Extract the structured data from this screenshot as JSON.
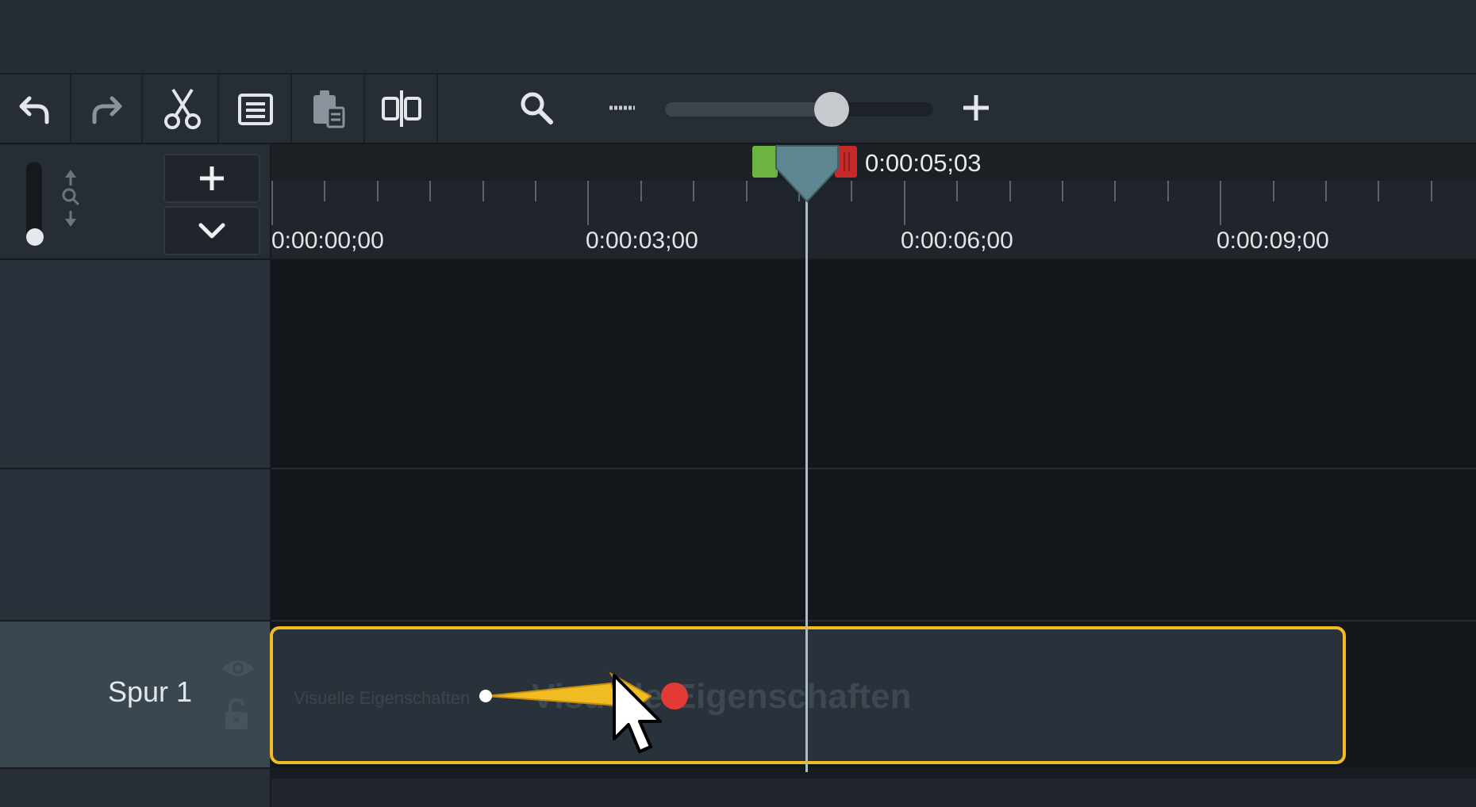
{
  "toolbar": {
    "buttons": [
      "undo-icon",
      "redo-icon",
      "cut-icon",
      "copy-icon",
      "paste-icon",
      "split-icon"
    ],
    "zoom_level": 0.62,
    "colors": {
      "accent": "#f1bc23",
      "playhead": "#5e8791",
      "in_marker": "#6cb43f",
      "out_marker": "#c52a2a"
    }
  },
  "timeline": {
    "playhead_time": "0:00:05;03",
    "ruler_labels": [
      "0:00:00;00",
      "0:00:03;00",
      "0:00:06;00",
      "0:00:09;00"
    ]
  },
  "tracks": [
    {
      "name": "Spur 1",
      "clip": {
        "title_small": "Visuelle Eigenschaften",
        "title_big": "Visuelle Eigenschaften"
      }
    }
  ]
}
